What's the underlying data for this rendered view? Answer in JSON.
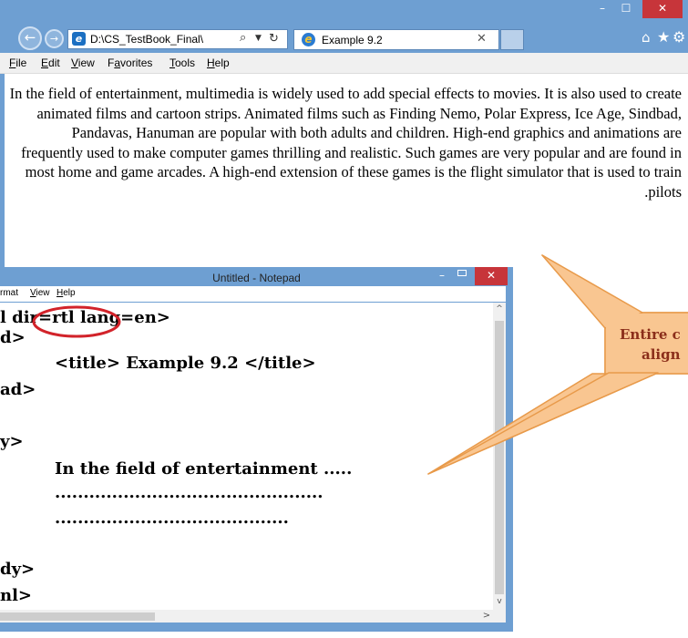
{
  "browser": {
    "window_controls": {
      "minimize": "–",
      "maximize": "☐",
      "close": "✕"
    },
    "address_bar": {
      "text": "D:\\CS_TestBook_Final\\"
    },
    "tab": {
      "title": "Example 9.2",
      "close": "✕"
    },
    "menu": [
      "File",
      "Edit",
      "View",
      "Favorites",
      "Tools",
      "Help"
    ],
    "menu_accel": [
      "F",
      "E",
      "V",
      "a",
      "T",
      "H"
    ],
    "page_text": "In the field of entertainment, multimedia is widely used to add special effects to movies. It is also used to create animated films and cartoon strips. Animated films such as Finding Nemo, Polar Express, Ice Age, Sindbad, Pandavas, Hanuman are popular with both adults and children. High-end graphics and animations are frequently used to make computer games thrilling and realistic. Such games are very popular and are found in most home and game arcades. A high-end extension of these games is the flight simulator that is used to train pilots."
  },
  "notepad": {
    "title": "Untitled - Notepad",
    "menu": [
      "rmat",
      "View",
      "Help"
    ],
    "code_lines": [
      "l dir=rtl lang=en>",
      "d>",
      "<title> Example 9.2 </title>",
      "ad>",
      "",
      "y>",
      "In the field of entertainment .....",
      "...............................................",
      ".........................................",
      "",
      "dy>",
      "nl>"
    ]
  },
  "callout": {
    "line1": "Entire c",
    "line2": "align",
    "fill_color": "#f9c691",
    "border_color": "#e89a4a",
    "text_color": "#8b2e1a"
  },
  "highlight": {
    "text": "dir=rtl",
    "color": "#d2232a"
  },
  "colors": {
    "window_frame": "#6e9fd2",
    "close_button": "#c7353a"
  }
}
